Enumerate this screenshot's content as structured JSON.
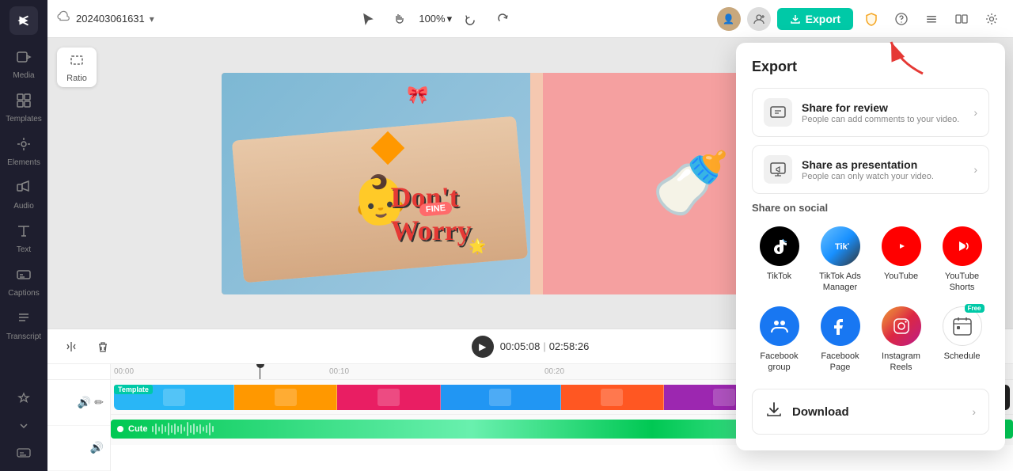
{
  "app": {
    "title": "CapCut"
  },
  "sidebar": {
    "logo_char": "✂",
    "items": [
      {
        "label": "Media",
        "icon": "⬜",
        "name": "media"
      },
      {
        "label": "Templates",
        "icon": "⬛",
        "name": "templates"
      },
      {
        "label": "Elements",
        "icon": "✦",
        "name": "elements"
      },
      {
        "label": "Audio",
        "icon": "♪",
        "name": "audio"
      },
      {
        "label": "Text",
        "icon": "T",
        "name": "text"
      },
      {
        "label": "Captions",
        "icon": "▭",
        "name": "captions"
      },
      {
        "label": "Transcript",
        "icon": "≡",
        "name": "transcript"
      }
    ],
    "bottom_items": [
      {
        "label": "star",
        "icon": "☆"
      },
      {
        "label": "chevron",
        "icon": "⌄"
      },
      {
        "label": "subtitles",
        "icon": "⬜"
      }
    ]
  },
  "topbar": {
    "filename": "202403061631",
    "zoom": "100%",
    "undo_label": "↩",
    "redo_label": "↪",
    "export_label": "Export"
  },
  "canvas": {
    "ratio_label": "Ratio"
  },
  "timeline": {
    "current_time": "00:05:08",
    "total_time": "02:58:26",
    "template_label": "Template",
    "audio_label": "Cute",
    "ruler_marks": [
      "00:00",
      "00:10",
      "00:20"
    ],
    "ruler_positions": [
      0,
      272,
      544
    ]
  },
  "export_panel": {
    "title": "Export",
    "share_review": {
      "title": "Share for review",
      "description": "People can add comments to your video."
    },
    "share_presentation": {
      "title": "Share as presentation",
      "description": "People can only watch your video."
    },
    "social_section_title": "Share on social",
    "social_items": [
      {
        "label": "TikTok",
        "color": "tiktok",
        "icon": "♪",
        "name": "tiktok"
      },
      {
        "label": "TikTok Ads Manager",
        "color": "tiktok-biz",
        "icon": "⬡",
        "name": "tiktok-ads"
      },
      {
        "label": "YouTube",
        "color": "youtube",
        "icon": "▶",
        "name": "youtube"
      },
      {
        "label": "YouTube Shorts",
        "color": "youtube-shorts",
        "icon": "▶",
        "name": "youtube-shorts"
      },
      {
        "label": "Facebook group",
        "color": "facebook",
        "icon": "👥",
        "name": "facebook-group"
      },
      {
        "label": "Facebook Page",
        "color": "facebook",
        "icon": "f",
        "name": "facebook-page"
      },
      {
        "label": "Instagram Reels",
        "color": "instagram",
        "icon": "◎",
        "name": "instagram-reels"
      },
      {
        "label": "Schedule",
        "color": "schedule",
        "icon": "📅",
        "name": "schedule",
        "badge": "Free"
      }
    ],
    "download": {
      "label": "Download",
      "icon": "⬇"
    }
  },
  "colors": {
    "accent": "#00c9a7",
    "export_btn_bg": "#00c9a7",
    "arrow_red": "#e53935"
  }
}
